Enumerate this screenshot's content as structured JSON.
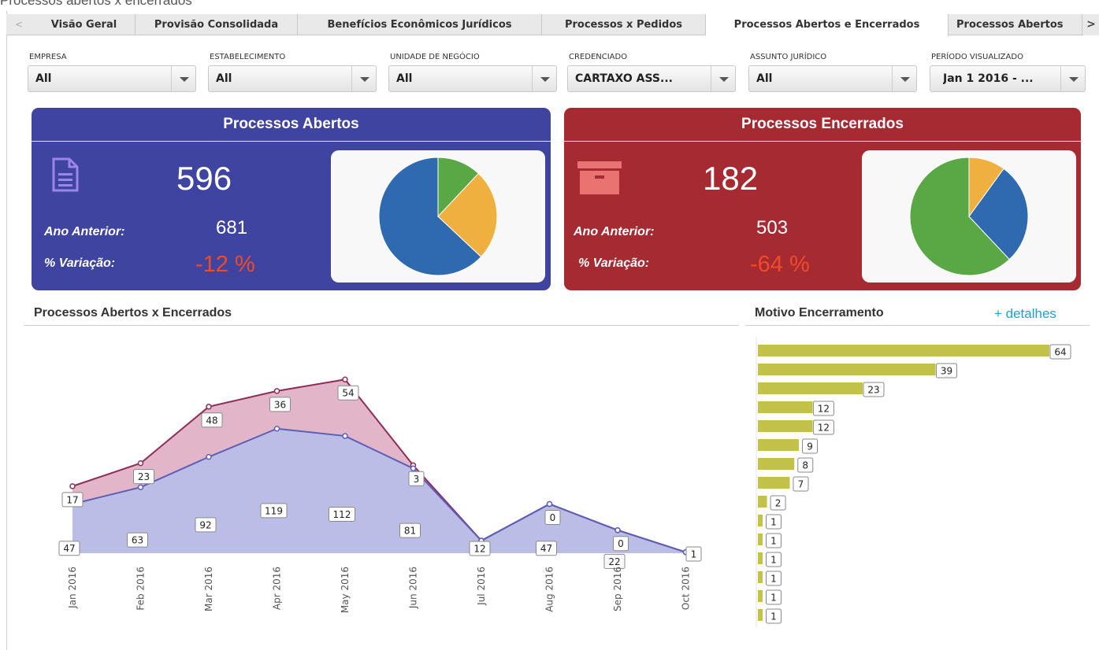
{
  "page_heading": "Processos abertos x encerrados",
  "tabs": [
    "Visão Geral",
    "Provisão Consolidada",
    "Benefícios Econômicos Jurídicos",
    "Processos x Pedidos",
    "Processos Abertos e Encerrados",
    "Processos Abertos"
  ],
  "active_tab": "Processos Abertos e Encerrados",
  "filters": [
    {
      "label": "EMPRESA",
      "value": "All"
    },
    {
      "label": "ESTABELECIMENTO",
      "value": "All"
    },
    {
      "label": "UNIDADE DE NEGÓCIO",
      "value": "All"
    },
    {
      "label": "CREDENCIADO",
      "value": "CARTAXO ASS..."
    },
    {
      "label": "ASSUNTO JURÍDICO",
      "value": "All"
    },
    {
      "label": "PERÍODO VISUALIZADO",
      "value": "Jan 1 2016 - ..."
    }
  ],
  "open_panel": {
    "title": "Processos Abertos",
    "value": "596",
    "prev_label": "Ano Anterior:",
    "prev_value": "681",
    "var_label": "% Variação:",
    "var_value": "-12 %",
    "icon": "document-icon",
    "color": "#3e44a0"
  },
  "closed_panel": {
    "title": "Processos Encerrados",
    "value": "182",
    "prev_label": "Ano Anterior:",
    "prev_value": "503",
    "var_label": "% Variação:",
    "var_value": "-64 %",
    "icon": "archive-box-icon",
    "color": "#a62a32"
  },
  "line_section": {
    "title": "Processos Abertos x Encerrados"
  },
  "bar_section": {
    "title": "Motivo Encerramento",
    "link": "+ detalhes"
  },
  "chart_data": [
    {
      "type": "pie",
      "values": [
        63,
        25,
        12
      ],
      "colors": [
        "#2f6ab0",
        "#f0b040",
        "#5aa746"
      ]
    },
    {
      "type": "pie",
      "values": [
        62,
        28,
        10
      ],
      "colors": [
        "#5aa746",
        "#2f6ab0",
        "#f0b040"
      ]
    },
    {
      "type": "area",
      "x": [
        "Jan 2016",
        "Feb 2016",
        "Mar 2016",
        "Apr 2016",
        "May 2016",
        "Jun 2016",
        "Jul 2016",
        "Aug 2016",
        "Sep 2016",
        "Oct 2016"
      ],
      "series": [
        {
          "values": [
            47,
            63,
            92,
            119,
            112,
            81,
            12,
            47,
            22,
            1
          ],
          "color": "#5b5fb8",
          "fill": "#bcbde6"
        },
        {
          "values": [
            17,
            23,
            48,
            36,
            54,
            3,
            null,
            0,
            0,
            null
          ],
          "color": "#8c2d5a",
          "fill": "#e2b6c8"
        }
      ],
      "stacked": true
    },
    {
      "type": "bar",
      "orientation": "horizontal",
      "values": [
        64,
        39,
        23,
        12,
        12,
        9,
        8,
        7,
        2,
        1,
        1,
        1,
        1,
        1,
        1
      ],
      "color": "#c2c24a"
    }
  ]
}
